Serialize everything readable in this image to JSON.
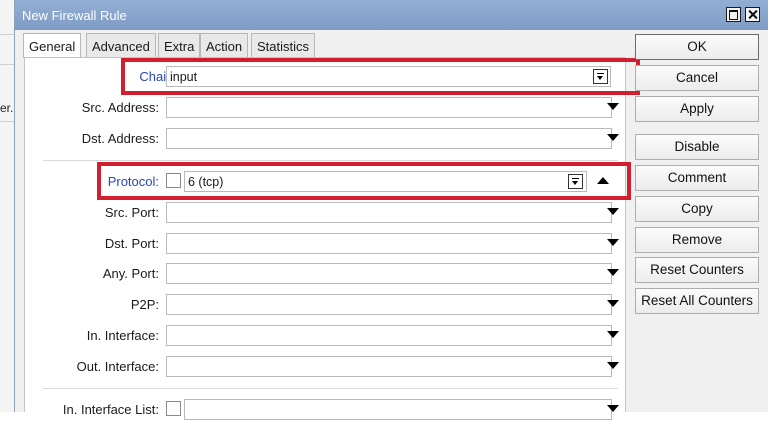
{
  "window": {
    "title": "New Firewall Rule"
  },
  "background": {
    "fragment": "er."
  },
  "tabs": [
    "General",
    "Advanced",
    "Extra",
    "Action",
    "Statistics"
  ],
  "fields": {
    "chain": {
      "label": "Chain:",
      "value": "input"
    },
    "src_address": {
      "label": "Src. Address:",
      "value": ""
    },
    "dst_address": {
      "label": "Dst. Address:",
      "value": ""
    },
    "protocol": {
      "label": "Protocol:",
      "value": "6 (tcp)"
    },
    "src_port": {
      "label": "Src. Port:",
      "value": ""
    },
    "dst_port": {
      "label": "Dst. Port:",
      "value": ""
    },
    "any_port": {
      "label": "Any. Port:",
      "value": ""
    },
    "p2p": {
      "label": "P2P:",
      "value": ""
    },
    "in_interface": {
      "label": "In. Interface:",
      "value": ""
    },
    "out_interface": {
      "label": "Out. Interface:",
      "value": ""
    },
    "in_interface_list": {
      "label": "In. Interface List:",
      "value": ""
    }
  },
  "buttons": [
    "OK",
    "Cancel",
    "Apply",
    "Disable",
    "Comment",
    "Copy",
    "Remove",
    "Reset Counters",
    "Reset All Counters"
  ],
  "colors": {
    "highlight": "#d21f2f",
    "link_label": "#2a45b8",
    "titlebar": "#86a3cb"
  }
}
